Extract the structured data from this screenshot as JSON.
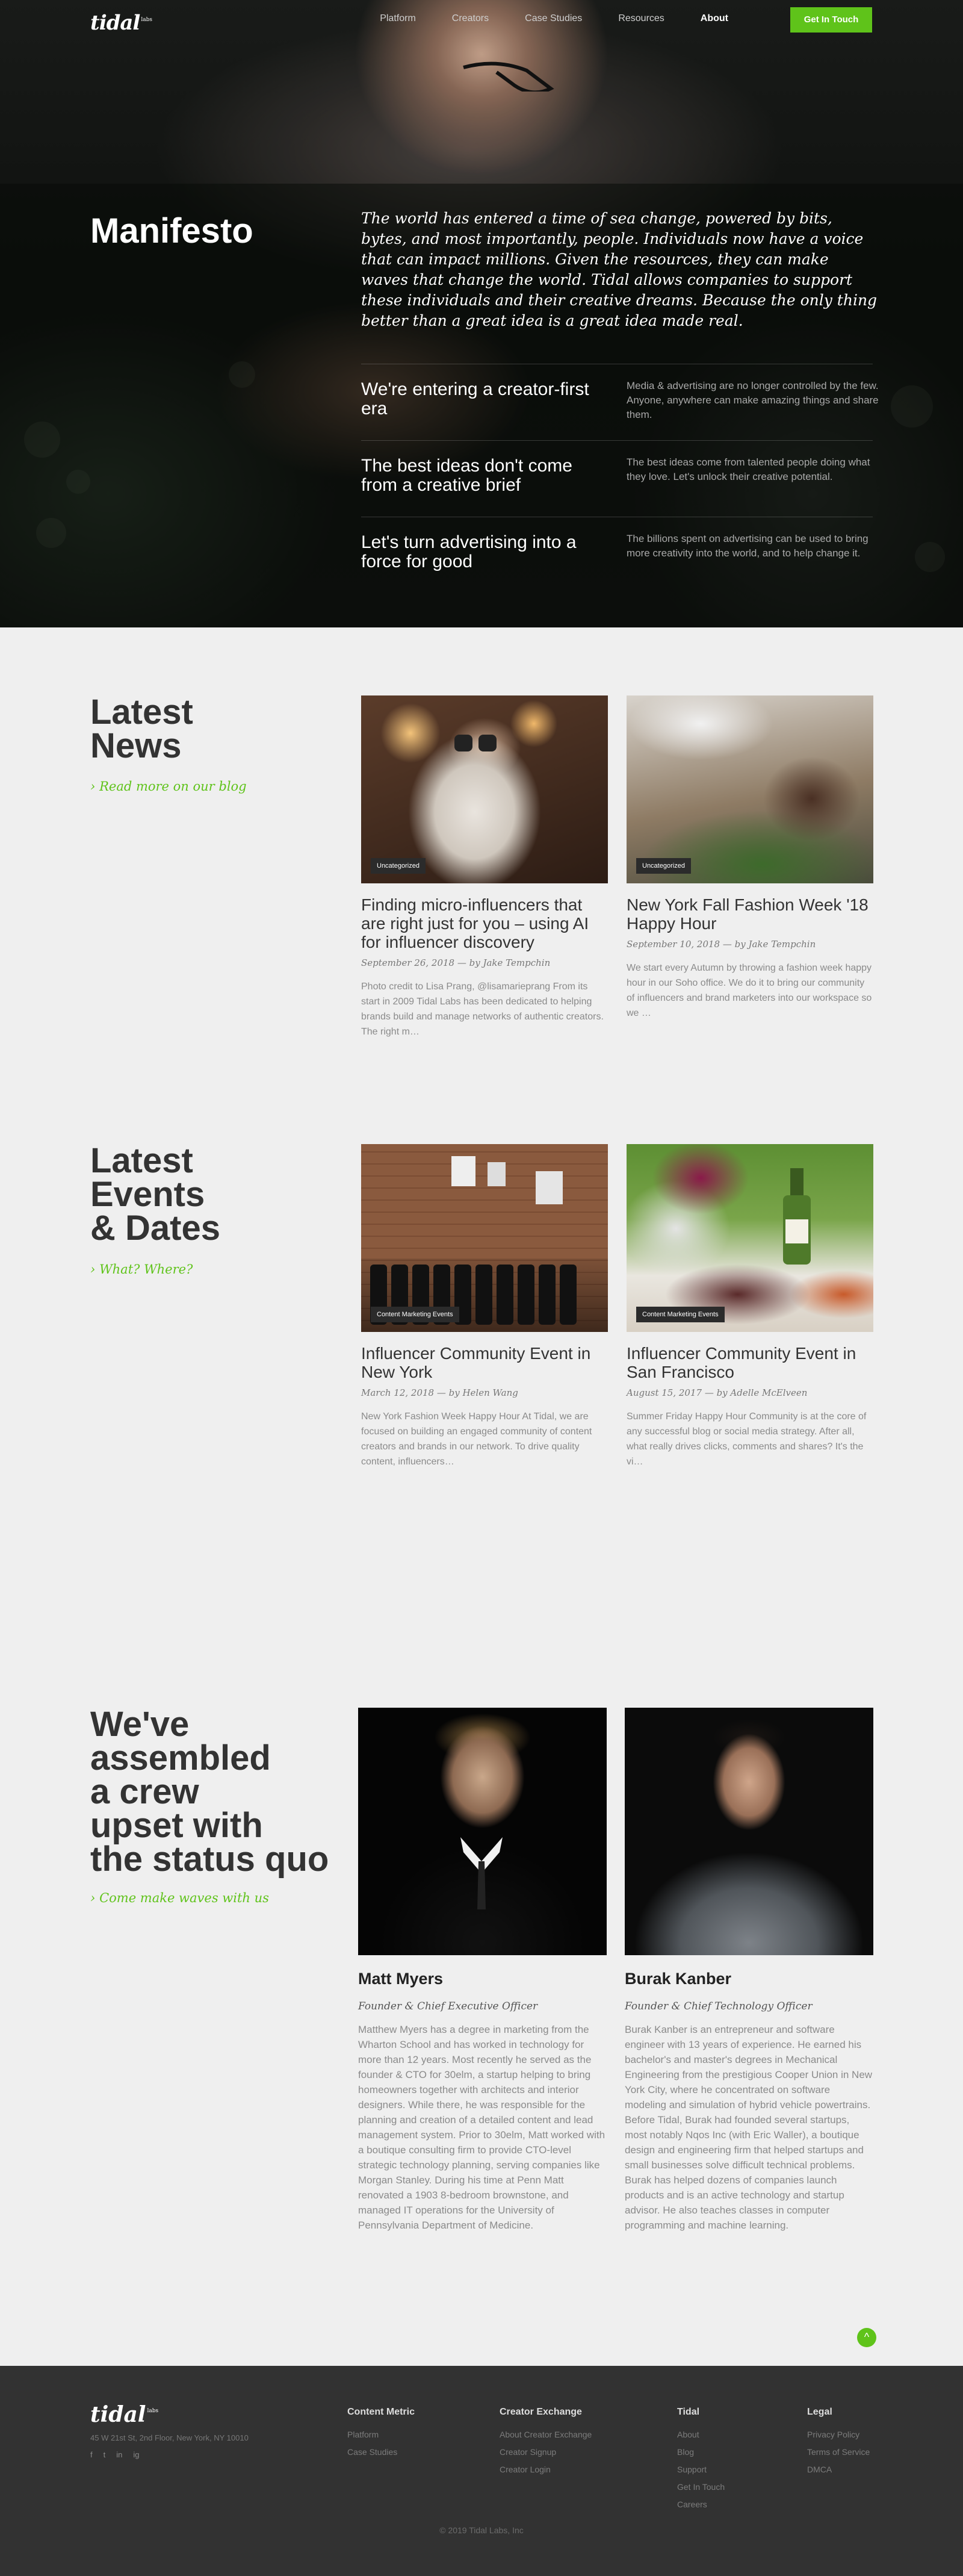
{
  "nav": {
    "logo": "tidal",
    "logo_sup": "labs",
    "links": [
      "Platform",
      "Creators",
      "Case Studies",
      "Resources",
      "About"
    ],
    "active": "About",
    "cta": "Get In Touch"
  },
  "hero": {
    "title": "Manifesto",
    "text": "The world has entered a time of sea change, powered by bits, bytes, and most importantly, people. Individuals now have a voice that can impact millions. Given the resources, they can make waves that change the world. Tidal allows companies to support these individuals and their creative dreams. Because the only thing better than a great idea is a great idea made real.",
    "pillars": [
      {
        "heading": "We're entering a creator-first era",
        "body": "Media & advertising are no longer controlled by the few. Anyone, anywhere can make amazing things and share them."
      },
      {
        "heading": "The best ideas don't come from a creative brief",
        "body": "The best ideas come from talented people doing what they love. Let's unlock their creative potential."
      },
      {
        "heading": "Let's turn advertising into a force for good",
        "body": "The billions spent on advertising can be used to bring more creativity into the world, and to help change it."
      }
    ]
  },
  "news": {
    "title_line1": "Latest",
    "title_line2": "News",
    "link": "› Read more on our blog",
    "posts": [
      {
        "tag": "Uncategorized",
        "title": "Finding micro-influencers that are right just for you – using AI for influencer discovery",
        "meta": "September 26, 2018 — by Jake Tempchin",
        "excerpt": "Photo credit to Lisa Prang, @lisamarieprang From its start in 2009 Tidal Labs has been dedicated to helping brands build and manage networks of authentic creators. The right m…"
      },
      {
        "tag": "Uncategorized",
        "title": "New York Fall Fashion Week '18 Happy Hour",
        "meta": "September 10, 2018 — by Jake Tempchin",
        "excerpt": "We start every Autumn by throwing a fashion week happy hour in our Soho office. We do it to bring our community of influencers and brand marketers into our workspace so we …"
      }
    ]
  },
  "events": {
    "title_line1": "Latest",
    "title_line2": "Events",
    "title_line3": "& Dates",
    "link": "› What? Where?",
    "posts": [
      {
        "tag": "Content Marketing Events",
        "title": "Influencer Community Event in New York",
        "meta": "March 12, 2018 — by Helen Wang",
        "excerpt": "New York Fashion Week Happy Hour At Tidal, we are focused on building an engaged community of content creators and brands in our network. To drive quality content, influencers…"
      },
      {
        "tag": "Content Marketing Events",
        "title": "Influencer Community Event in San Francisco",
        "meta": "August 15, 2017 — by Adelle McElveen",
        "excerpt": "Summer Friday Happy Hour Community is at the core of any successful blog or social media strategy. After all, what really drives clicks, comments and shares? It's the vi…"
      }
    ]
  },
  "team": {
    "title_lines": [
      "We've",
      "assembled",
      "a crew",
      "upset with",
      "the status quo"
    ],
    "link": "› Come make waves with us",
    "members": [
      {
        "name": "Matt Myers",
        "role": "Founder & Chief Executive Officer",
        "bio": "Matthew Myers has a degree in marketing from the Wharton School and has worked in technology for more than 12 years. Most recently he served as the founder & CTO for 30elm, a startup helping to bring homeowners together with architects and interior designers. While there, he was responsible for the planning and creation of a detailed content and lead management system. Prior to 30elm, Matt worked with a boutique consulting firm to provide CTO-level strategic technology planning, serving companies like Morgan Stanley. During his time at Penn Matt renovated a 1903 8-bedroom brownstone, and managed IT operations for the University of Pennsylvania Department of Medicine."
      },
      {
        "name": "Burak Kanber",
        "role": "Founder & Chief Technology Officer",
        "bio": "Burak Kanber is an entrepreneur and software engineer with 13 years of experience. He earned his bachelor's and master's degrees in Mechanical Engineering from the prestigious Cooper Union in New York City, where he concentrated on software modeling and simulation of hybrid vehicle powertrains. Before Tidal, Burak had founded several startups, most notably Nqos Inc (with Eric Waller), a boutique design and engineering firm that helped startups and small businesses solve difficult technical problems. Burak has helped dozens of companies launch products and is an active technology and startup advisor. He also teaches classes in computer programming and machine learning."
      }
    ]
  },
  "back_to_top": "^",
  "footer": {
    "logo": "tidal",
    "logo_sup": "labs",
    "address": "45 W 21st St, 2nd Floor, New York, NY 10010",
    "social": [
      "f",
      "t",
      "in",
      "ig"
    ],
    "columns": [
      {
        "title": "Content Metric",
        "links": [
          "Platform",
          "Case Studies"
        ]
      },
      {
        "title": "Creator Exchange",
        "links": [
          "About Creator Exchange",
          "Creator Signup",
          "Creator Login"
        ]
      },
      {
        "title": "Tidal",
        "links": [
          "About",
          "Blog",
          "Support",
          "Get In Touch",
          "Careers"
        ]
      },
      {
        "title": "Legal",
        "links": [
          "Privacy Policy",
          "Terms of Service",
          "DMCA"
        ]
      }
    ],
    "copyright": "© 2019 Tidal Labs, Inc"
  },
  "colors": {
    "accent": "#5fc31a",
    "footer_bg": "#323232",
    "page_bg": "#efefef"
  }
}
